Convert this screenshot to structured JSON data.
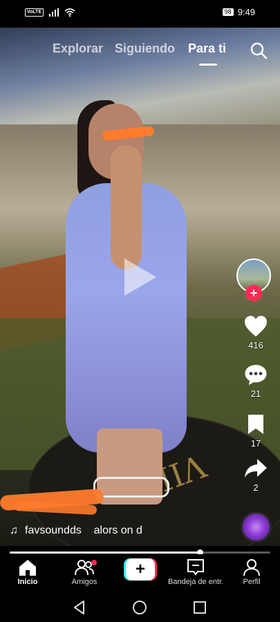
{
  "status_bar": {
    "volte": "VoLTE",
    "battery": "98",
    "time": "9:49",
    "icons": [
      "signal-icon",
      "wifi-icon"
    ]
  },
  "top_tabs": {
    "items": [
      {
        "label": "Explorar",
        "active": false
      },
      {
        "label": "Siguiendo",
        "active": false
      },
      {
        "label": "Para ti",
        "active": true
      }
    ],
    "search_icon": "search-icon"
  },
  "video": {
    "playing": false,
    "overlay_icon": "play-icon",
    "progress": 0.73,
    "stage_text": "VIIJ"
  },
  "rail": {
    "avatar_icon": "avatar",
    "follow_icon": "plus-icon",
    "likes": "416",
    "comments": "21",
    "saves": "17",
    "shares": "2"
  },
  "caption": {
    "sound_prefix_icon": "music-note-icon",
    "sound_text": "favsoundds    alors on d"
  },
  "bottom_nav": {
    "items": [
      {
        "label": "Inicio",
        "icon": "home-icon",
        "active": true
      },
      {
        "label": "Amigos",
        "icon": "friends-icon",
        "active": false
      },
      {
        "label": "",
        "icon": "create-icon",
        "active": false
      },
      {
        "label": "Bandeja de entr...",
        "icon": "inbox-icon",
        "active": false
      },
      {
        "label": "Perfil",
        "icon": "profile-icon",
        "active": false
      }
    ]
  },
  "system_nav": [
    "back-icon",
    "home-circle-icon",
    "recents-icon"
  ],
  "colors": {
    "accent": "#fe2c55",
    "cyan": "#25f4ee",
    "redaction": "#ff7b2c"
  }
}
